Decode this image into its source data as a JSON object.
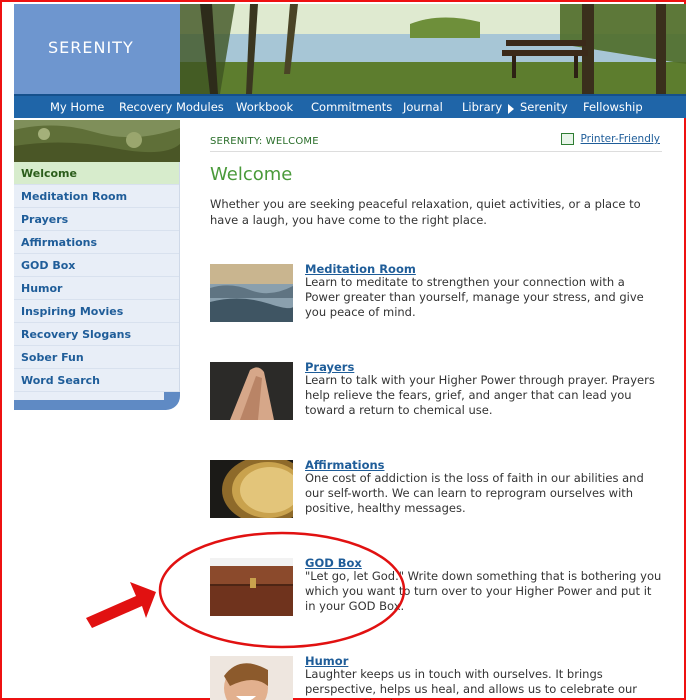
{
  "brand": {
    "name": "SERENITY"
  },
  "nav": {
    "items": [
      {
        "label": "My Home"
      },
      {
        "label": "Recovery Modules"
      },
      {
        "label": "Workbook"
      },
      {
        "label": "Commitments"
      },
      {
        "label": "Journal"
      },
      {
        "label": "Library"
      },
      {
        "label": "Serenity"
      },
      {
        "label": "Fellowship"
      }
    ],
    "active": "Serenity"
  },
  "sidebar": {
    "items": [
      {
        "label": "Welcome"
      },
      {
        "label": "Meditation Room"
      },
      {
        "label": "Prayers"
      },
      {
        "label": "Affirmations"
      },
      {
        "label": "GOD Box"
      },
      {
        "label": "Humor"
      },
      {
        "label": "Inspiring Movies"
      },
      {
        "label": "Recovery Slogans"
      },
      {
        "label": "Sober Fun"
      },
      {
        "label": "Word Search"
      }
    ],
    "active": "Welcome"
  },
  "main": {
    "breadcrumb": "SERENITY: WELCOME",
    "printer_label": "Printer-Friendly",
    "title": "Welcome",
    "intro": "Whether you are seeking peaceful relaxation, quiet activities, or a place to have a laugh, you have come to the right place.",
    "entries": [
      {
        "title": "Meditation Room",
        "desc": "Learn to meditate to strengthen your connection with a Power greater than yourself, manage your stress, and give you peace of mind."
      },
      {
        "title": "Prayers",
        "desc": "Learn to talk with your Higher Power through prayer. Prayers help relieve the fears, grief, and anger that can lead you toward a return to chemical use."
      },
      {
        "title": "Affirmations",
        "desc": "One cost of addiction is the loss of faith in our abilities and our self-worth. We can learn to reprogram ourselves with positive, healthy messages."
      },
      {
        "title": "GOD Box",
        "desc": "\"Let go, let God.\" Write down something that is bothering you which you want to turn over to your Higher Power and put it in your GOD Box."
      },
      {
        "title": "Humor",
        "desc": "Laughter keeps us in touch with ourselves. It brings perspective, helps us heal, and allows us to celebrate our recovery. Check out"
      }
    ]
  },
  "colors": {
    "nav_bg": "#1f65a8",
    "brand_bg": "#6e96cf",
    "title_green": "#4a9a3a",
    "link_blue": "#1f5d99",
    "annotation_red": "#e11111"
  }
}
